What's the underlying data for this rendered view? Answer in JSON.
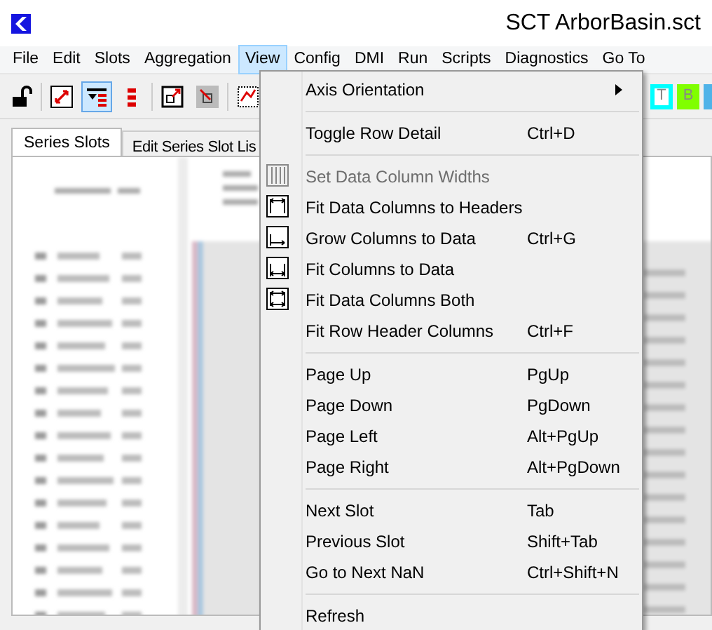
{
  "window": {
    "title": "SCT ArborBasin.sct"
  },
  "menu_bar": [
    {
      "label": "File",
      "selected": false
    },
    {
      "label": "Edit",
      "selected": false
    },
    {
      "label": "Slots",
      "selected": false
    },
    {
      "label": "Aggregation",
      "selected": false
    },
    {
      "label": "View",
      "selected": true
    },
    {
      "label": "Config",
      "selected": false
    },
    {
      "label": "DMI",
      "selected": false
    },
    {
      "label": "Run",
      "selected": false
    },
    {
      "label": "Scripts",
      "selected": false
    },
    {
      "label": "Diagnostics",
      "selected": false
    },
    {
      "label": "Go To",
      "selected": false
    }
  ],
  "toolbar": {
    "buttons": [
      {
        "selected": false
      },
      {
        "selected": false
      },
      {
        "selected": true
      },
      {
        "selected": false
      },
      {
        "selected": false
      },
      {
        "selected": false
      },
      {
        "selected": false
      }
    ],
    "color_buttons": [
      {
        "label": "T",
        "color": "#00ffff"
      },
      {
        "label": "B",
        "color": "#80ff00"
      },
      {
        "color": "#4fb3e8"
      }
    ]
  },
  "tabs": [
    {
      "label": "Series Slots",
      "selected": true
    },
    {
      "label": "Edit Series Slot Lis",
      "selected": false
    }
  ],
  "view_menu": [
    {
      "kind": "submenu",
      "label": "Axis Orientation"
    },
    {
      "kind": "separator"
    },
    {
      "kind": "item",
      "label": "Toggle Row Detail",
      "shortcut": "Ctrl+D",
      "disabled": false,
      "icon": false
    },
    {
      "kind": "separator"
    },
    {
      "kind": "item",
      "label": "Set Data Column Widths",
      "disabled": true,
      "icon": true
    },
    {
      "kind": "item",
      "label": "Fit Data Columns to Headers",
      "disabled": false,
      "icon": true
    },
    {
      "kind": "item",
      "label": "Grow Columns to Data",
      "shortcut": "Ctrl+G",
      "disabled": false,
      "icon": true
    },
    {
      "kind": "item",
      "label": "Fit Columns to Data",
      "disabled": false,
      "icon": true
    },
    {
      "kind": "item",
      "label": "Fit Data Columns Both",
      "disabled": false,
      "icon": true
    },
    {
      "kind": "item",
      "label": "Fit Row Header Columns",
      "shortcut": "Ctrl+F",
      "disabled": false,
      "icon": false
    },
    {
      "kind": "separator"
    },
    {
      "kind": "item",
      "label": "Page Up",
      "shortcut": "PgUp",
      "disabled": false,
      "icon": false
    },
    {
      "kind": "item",
      "label": "Page Down",
      "shortcut": "PgDown",
      "disabled": false,
      "icon": false
    },
    {
      "kind": "item",
      "label": "Page Left",
      "shortcut": "Alt+PgUp",
      "disabled": false,
      "icon": false
    },
    {
      "kind": "item",
      "label": "Page Right",
      "shortcut": "Alt+PgDown",
      "disabled": false,
      "icon": false
    },
    {
      "kind": "separator"
    },
    {
      "kind": "item",
      "label": "Next Slot",
      "shortcut": "Tab",
      "disabled": false,
      "icon": false
    },
    {
      "kind": "item",
      "label": "Previous Slot",
      "shortcut": "Shift+Tab",
      "disabled": false,
      "icon": false
    },
    {
      "kind": "item",
      "label": "Go to Next NaN",
      "shortcut": "Ctrl+Shift+N",
      "disabled": false,
      "icon": false
    },
    {
      "kind": "separator"
    },
    {
      "kind": "item",
      "label": "Refresh",
      "disabled": false,
      "icon": false
    }
  ]
}
